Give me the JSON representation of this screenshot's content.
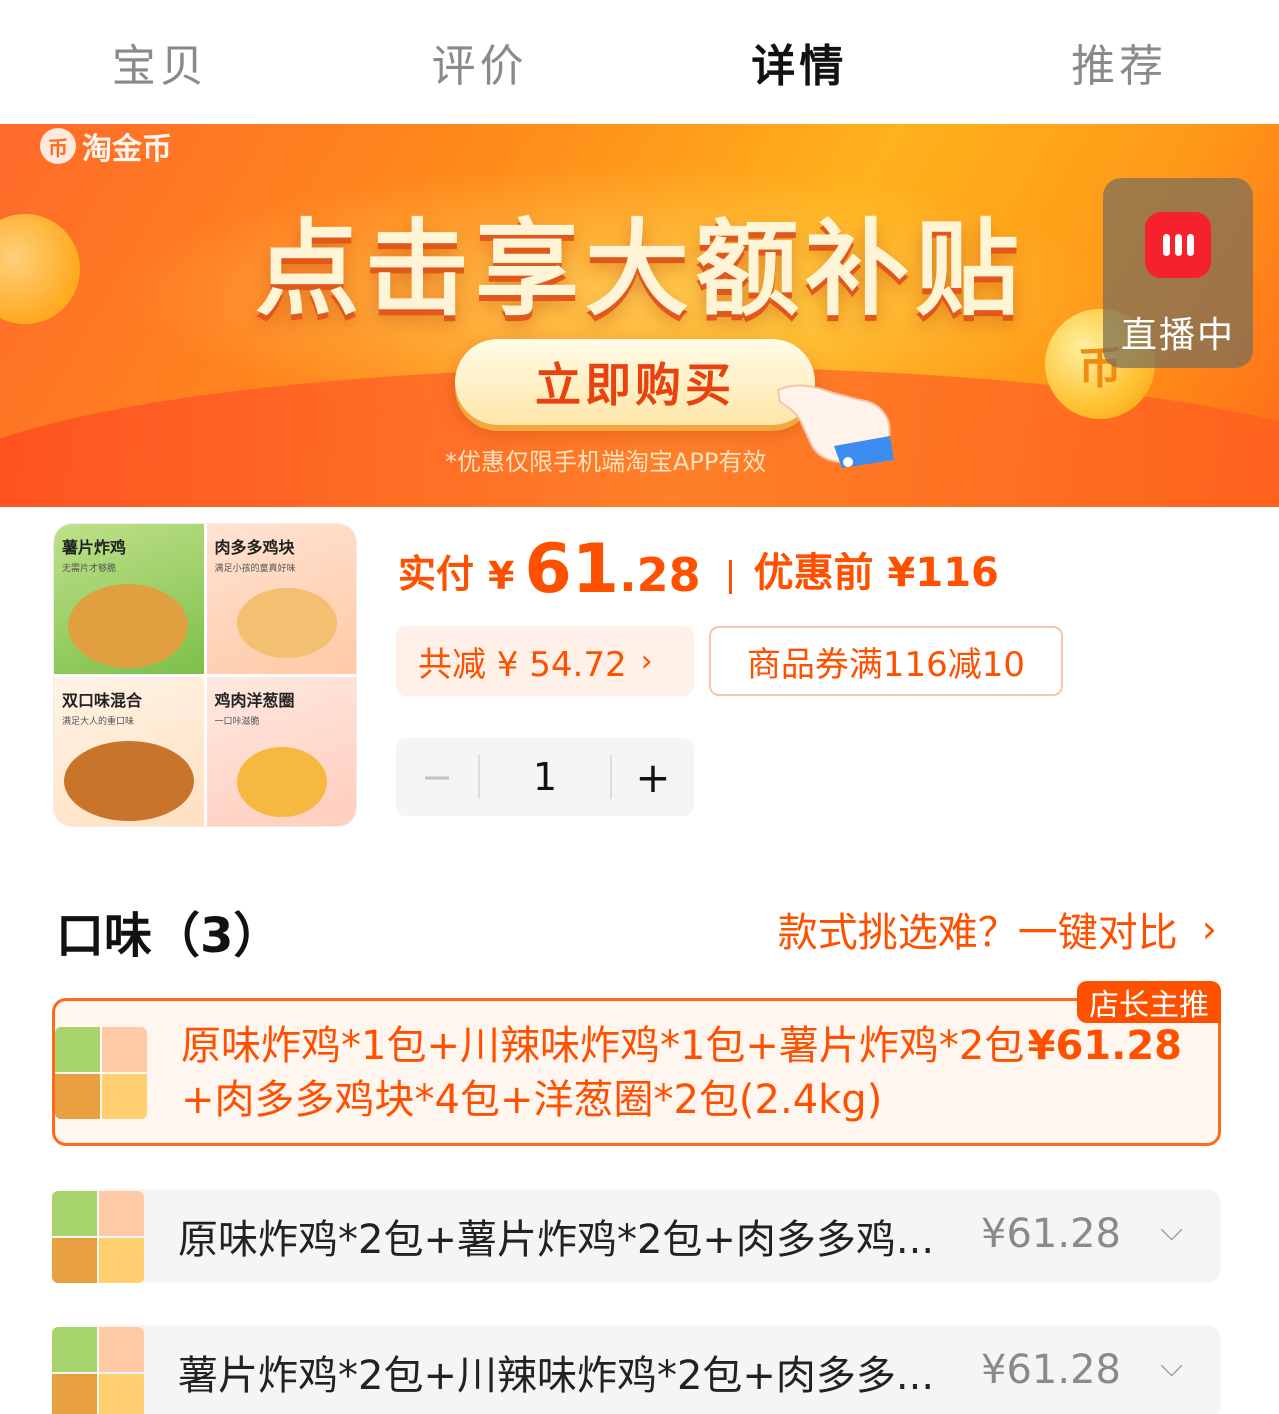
{
  "tabs": [
    {
      "label": "宝贝",
      "active": false
    },
    {
      "label": "评价",
      "active": false
    },
    {
      "label": "详情",
      "active": true
    },
    {
      "label": "推荐",
      "active": false
    }
  ],
  "banner": {
    "logo_icon": "币",
    "logo_text": "淘金币",
    "headline": "点击享大额补贴",
    "button": "立即购买",
    "note": "*优惠仅限手机端淘宝APP有效",
    "coin_glyph": "币",
    "colors": {
      "start": "#ff6a2a",
      "end": "#ffb21c"
    }
  },
  "live": {
    "label": "直播中",
    "icon": "live-bars-icon",
    "color": "#f5222d"
  },
  "product": {
    "thumbnail": [
      {
        "title": "薯片炸鸡",
        "sub": "无需片才够脆"
      },
      {
        "title": "肉多多鸡块",
        "sub": "满足小孩的童真好味"
      },
      {
        "title": "双口味混合",
        "sub": "满足大人的重口味"
      },
      {
        "title": "鸡肉洋葱圈",
        "sub": "一口咔滋脆"
      }
    ],
    "price_label": "实付",
    "currency": "¥",
    "price_int": "61",
    "price_dec": ".28",
    "before_label": "优惠前 ¥116",
    "reduce_label": "共减 ¥ 54.72",
    "reduce_chevron": "›",
    "coupon": "商品券满116减10",
    "quantity": "1",
    "minus": "−",
    "plus": "+",
    "accent_color": "#ff5000"
  },
  "flavor": {
    "title": "口味（3）",
    "compare_label": "款式挑选难？一键对比",
    "compare_chevron": "›",
    "selected_tag": "店长主推",
    "options": [
      {
        "text": "原味炸鸡*1包+川辣味炸鸡*1包+薯片炸鸡*2包+肉多多鸡块*4包+洋葱圈*2包(2.4kg)",
        "price": "¥61.28",
        "selected": true
      },
      {
        "text": "原味炸鸡*2包+薯片炸鸡*2包+肉多多鸡...",
        "price": "¥61.28",
        "selected": false
      },
      {
        "text": "薯片炸鸡*2包+川辣味炸鸡*2包+肉多多...",
        "price": "¥61.28",
        "selected": false
      }
    ],
    "chevron_down": "⌵"
  }
}
